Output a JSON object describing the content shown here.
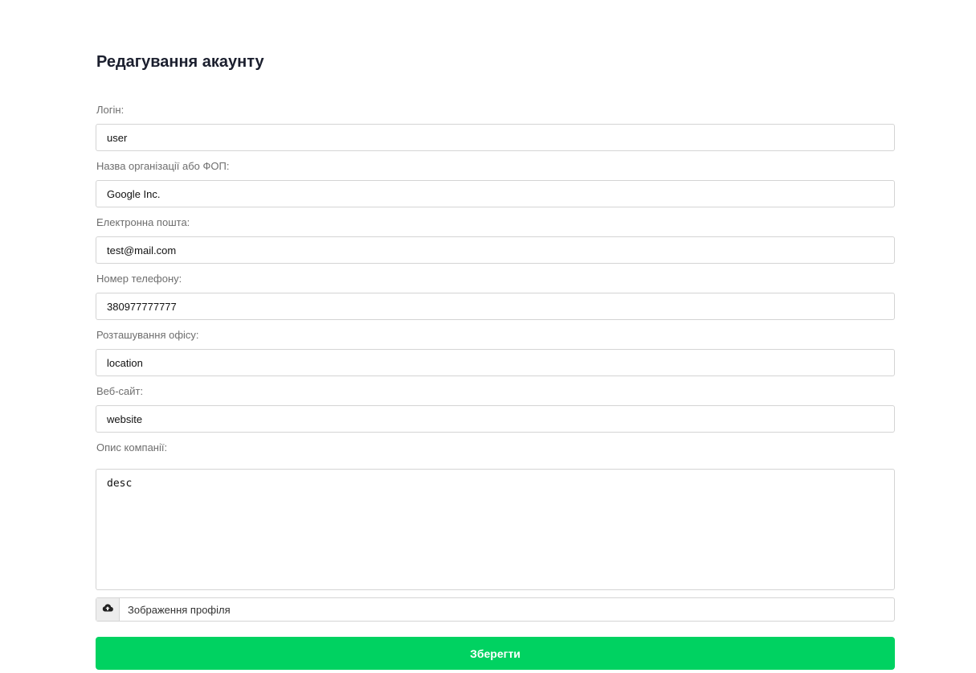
{
  "form": {
    "title": "Редагування акаунту",
    "fields": {
      "login": {
        "label": "Логін:",
        "value": "user"
      },
      "organization": {
        "label": "Назва організації або ФОП:",
        "value": "Google Inc."
      },
      "email": {
        "label": "Електронна пошта:",
        "value": "test@mail.com"
      },
      "phone": {
        "label": "Номер телефону:",
        "value": "380977777777"
      },
      "location": {
        "label": "Розташування офісу:",
        "value": "location"
      },
      "website": {
        "label": "Веб-сайт:",
        "value": "website"
      },
      "description": {
        "label": "Опис компанії:",
        "value": "desc"
      }
    },
    "file_upload": {
      "label": "Зображення профіля",
      "icon": "cloud-upload-icon"
    },
    "save_label": "Зберегти"
  },
  "colors": {
    "accent": "#00d261",
    "title": "#1b1f2e",
    "label": "#6e6e6e",
    "border": "#d4d4d4"
  }
}
